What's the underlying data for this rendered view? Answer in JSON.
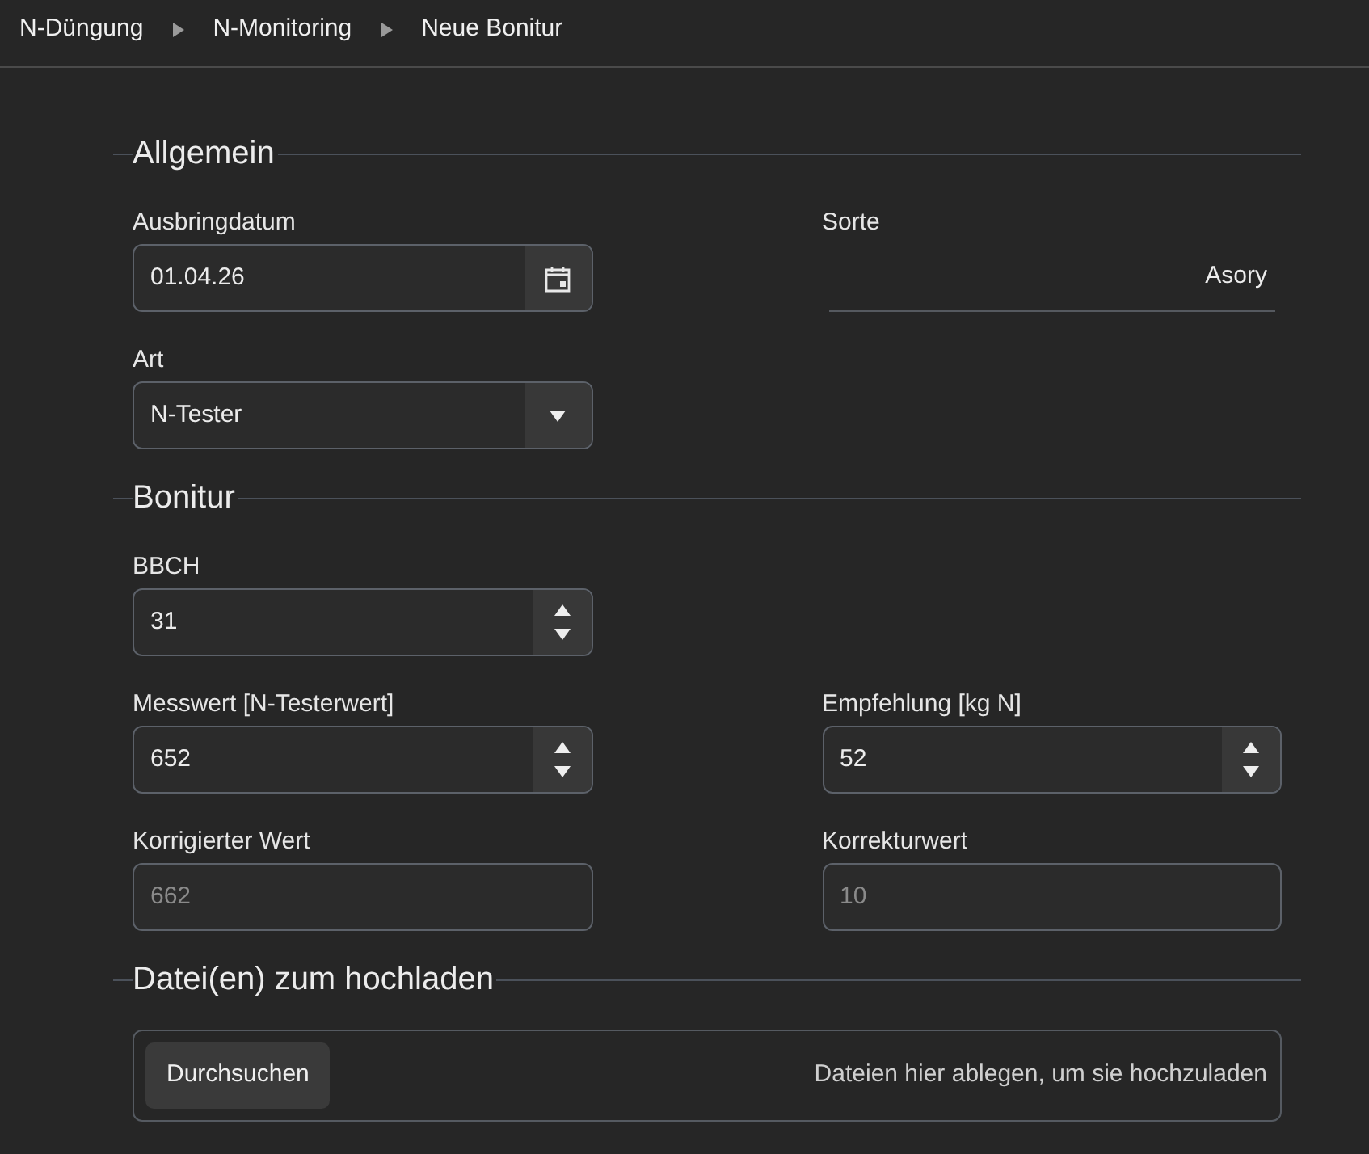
{
  "breadcrumb": [
    {
      "label": "N-Düngung"
    },
    {
      "label": "N-Monitoring"
    },
    {
      "label": "Neue Bonitur"
    }
  ],
  "sections": [
    {
      "title": "Allgemein",
      "rows": [
        [
          {
            "kind": "date",
            "label": "Ausbringdatum",
            "value": "01.04.26",
            "disabled": false
          },
          {
            "kind": "display",
            "label": "Sorte",
            "value": "Asory",
            "disabled": false
          }
        ],
        [
          {
            "kind": "select",
            "label": "Art",
            "value": "N-Tester",
            "disabled": false
          }
        ]
      ]
    },
    {
      "title": "Bonitur",
      "rows": [
        [
          {
            "kind": "number",
            "label": "BBCH",
            "value": "31",
            "disabled": false
          }
        ],
        [
          {
            "kind": "number",
            "label": "Messwert [N-Testerwert]",
            "value": "652",
            "disabled": false
          },
          {
            "kind": "number",
            "label": "Empfehlung [kg N]",
            "value": "52",
            "disabled": false
          }
        ],
        [
          {
            "kind": "text",
            "label": "Korrigierter Wert",
            "value": "662",
            "disabled": true
          },
          {
            "kind": "text",
            "label": "Korrekturwert",
            "value": "10",
            "disabled": true
          }
        ]
      ]
    },
    {
      "title": "Datei(en) zum hochladen",
      "upload": {
        "button": "Durchsuchen",
        "hint": "Dateien hier ablegen, um sie hochzuladen"
      }
    }
  ]
}
